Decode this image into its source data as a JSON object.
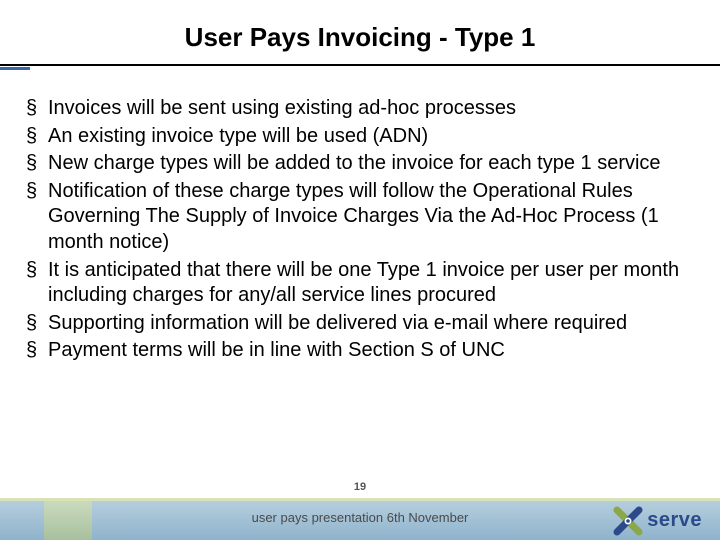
{
  "title": "User Pays Invoicing - Type 1",
  "bullets": [
    "Invoices will be sent using existing ad-hoc processes",
    "An existing invoice type will be used (ADN)",
    "New charge types will be added to the invoice for each type 1 service",
    "Notification of these charge types will follow the Operational Rules Governing The Supply of Invoice Charges Via the Ad-Hoc Process (1 month notice)",
    "It is anticipated that there will be one Type 1 invoice per user per month including charges for any/all service lines procured",
    "Supporting information will be delivered via e-mail where required",
    "Payment terms will be in line with Section S of UNC"
  ],
  "page_number": "19",
  "footer_text": "user pays presentation 6th November",
  "logo_text": "serve"
}
